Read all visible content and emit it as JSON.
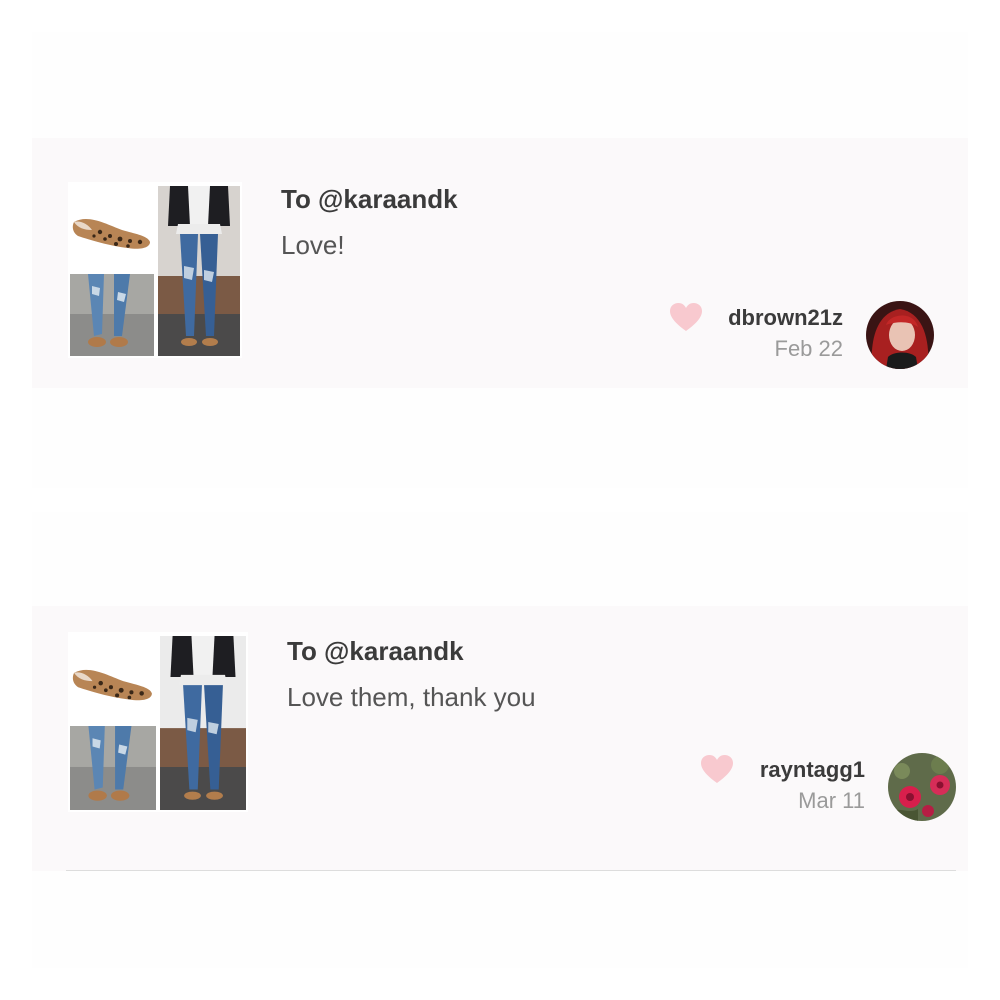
{
  "comments": [
    {
      "recipient": "To @karaandk",
      "message": "Love!",
      "username": "dbrown21z",
      "date": "Feb 22",
      "icon": "heart-icon"
    },
    {
      "recipient": "To @karaandk",
      "message": "Love them, thank you",
      "username": "rayntagg1",
      "date": "Mar 11",
      "icon": "heart-icon"
    }
  ],
  "colors": {
    "heart": "#f8c9cf",
    "card_background": "#fbf9fa",
    "username": "#3b3b3b",
    "date": "#9a9a9a"
  }
}
